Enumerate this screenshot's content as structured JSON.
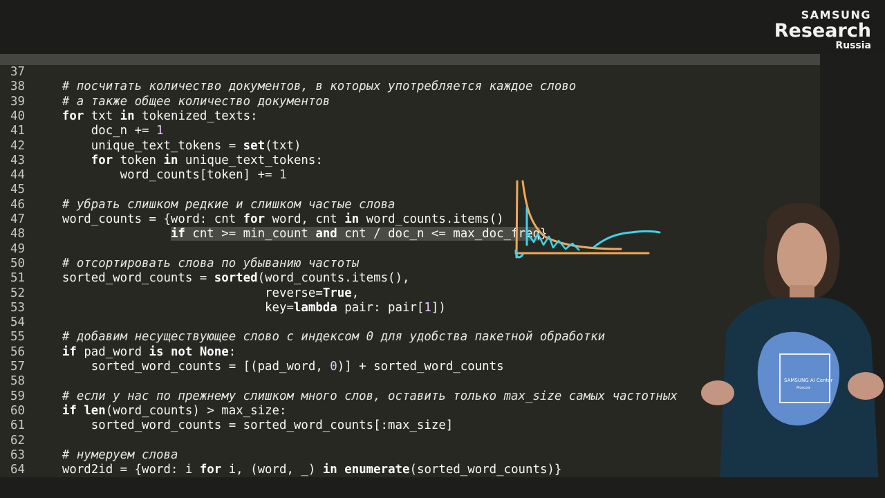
{
  "header": {
    "faded_title": "",
    "brand": {
      "line1": "SAMSUNG",
      "line2": "Research",
      "line3": "Russia"
    }
  },
  "editor": {
    "lines": [
      {
        "n": "37",
        "segs": []
      },
      {
        "n": "38",
        "segs": [
          {
            "t": "    "
          },
          {
            "t": "# посчитать количество документов, в которых употребляется каждое слово",
            "c": "cm"
          }
        ]
      },
      {
        "n": "39",
        "segs": [
          {
            "t": "    "
          },
          {
            "t": "# а также общее количество документов",
            "c": "cm"
          }
        ]
      },
      {
        "n": "40",
        "segs": [
          {
            "t": "    "
          },
          {
            "t": "for",
            "c": "kw"
          },
          {
            "t": " txt "
          },
          {
            "t": "in",
            "c": "kw"
          },
          {
            "t": " tokenized_texts:"
          }
        ]
      },
      {
        "n": "41",
        "segs": [
          {
            "t": "        doc_n += "
          },
          {
            "t": "1",
            "c": "num"
          }
        ]
      },
      {
        "n": "42",
        "segs": [
          {
            "t": "        unique_text_tokens = "
          },
          {
            "t": "set",
            "c": "kw"
          },
          {
            "t": "(txt)"
          }
        ]
      },
      {
        "n": "43",
        "segs": [
          {
            "t": "        "
          },
          {
            "t": "for",
            "c": "kw"
          },
          {
            "t": " token "
          },
          {
            "t": "in",
            "c": "kw"
          },
          {
            "t": " unique_text_tokens:"
          }
        ]
      },
      {
        "n": "44",
        "segs": [
          {
            "t": "            word_counts[token] += "
          },
          {
            "t": "1",
            "c": "num"
          }
        ]
      },
      {
        "n": "45",
        "segs": []
      },
      {
        "n": "46",
        "segs": [
          {
            "t": "    "
          },
          {
            "t": "# убрать слишком редкие и слишком частые слова",
            "c": "cm"
          }
        ]
      },
      {
        "n": "47",
        "segs": [
          {
            "t": "    word_counts = {word: cnt "
          },
          {
            "t": "for",
            "c": "kw"
          },
          {
            "t": " word, cnt "
          },
          {
            "t": "in",
            "c": "kw"
          },
          {
            "t": " word_counts.items()"
          }
        ]
      },
      {
        "n": "48",
        "segs": [
          {
            "t": "                   "
          },
          {
            "t": "if",
            "c": "kw hl"
          },
          {
            "t": " cnt >= min_count ",
            "c": "hl"
          },
          {
            "t": "and",
            "c": "kw hl"
          },
          {
            "t": " cnt / doc_n <= max_doc_freq",
            "c": "hl"
          },
          {
            "t": "}"
          }
        ]
      },
      {
        "n": "49",
        "segs": []
      },
      {
        "n": "50",
        "segs": [
          {
            "t": "    "
          },
          {
            "t": "# отсортировать слова по убыванию частоты",
            "c": "cm"
          }
        ]
      },
      {
        "n": "51",
        "segs": [
          {
            "t": "    sorted_word_counts = "
          },
          {
            "t": "sorted",
            "c": "kw"
          },
          {
            "t": "(word_counts.items(),"
          }
        ]
      },
      {
        "n": "52",
        "segs": [
          {
            "t": "                                reverse="
          },
          {
            "t": "True",
            "c": "kw"
          },
          {
            "t": ","
          }
        ]
      },
      {
        "n": "53",
        "segs": [
          {
            "t": "                                key="
          },
          {
            "t": "lambda",
            "c": "kw"
          },
          {
            "t": " pair: pair["
          },
          {
            "t": "1",
            "c": "num"
          },
          {
            "t": "])"
          }
        ]
      },
      {
        "n": "54",
        "segs": []
      },
      {
        "n": "55",
        "segs": [
          {
            "t": "    "
          },
          {
            "t": "# добавим несуществующее слово с индексом 0 для удобства пакетной обработки",
            "c": "cm"
          }
        ]
      },
      {
        "n": "56",
        "segs": [
          {
            "t": "    "
          },
          {
            "t": "if",
            "c": "kw"
          },
          {
            "t": " pad_word "
          },
          {
            "t": "is not None",
            "c": "kw"
          },
          {
            "t": ":"
          }
        ]
      },
      {
        "n": "57",
        "segs": [
          {
            "t": "        sorted_word_counts = [(pad_word, "
          },
          {
            "t": "0",
            "c": "num"
          },
          {
            "t": ")] + sorted_word_counts"
          }
        ]
      },
      {
        "n": "58",
        "segs": []
      },
      {
        "n": "59",
        "segs": [
          {
            "t": "    "
          },
          {
            "t": "# если у нас по прежнему слишком много слов, оставить только max_size самых частотных",
            "c": "cm"
          }
        ]
      },
      {
        "n": "60",
        "segs": [
          {
            "t": "    "
          },
          {
            "t": "if",
            "c": "kw"
          },
          {
            "t": " "
          },
          {
            "t": "len",
            "c": "kw"
          },
          {
            "t": "(word_counts) > max_size:"
          }
        ]
      },
      {
        "n": "61",
        "segs": [
          {
            "t": "        sorted_word_counts = sorted_word_counts[:max_size]"
          }
        ]
      },
      {
        "n": "62",
        "segs": []
      },
      {
        "n": "63",
        "segs": [
          {
            "t": "    "
          },
          {
            "t": "# нумеруем слова",
            "c": "cm"
          }
        ]
      },
      {
        "n": "64",
        "segs": [
          {
            "t": "    word2id = {word: i "
          },
          {
            "t": "for",
            "c": "kw"
          },
          {
            "t": " i, (word, _) "
          },
          {
            "t": "in",
            "c": "kw"
          },
          {
            "t": " "
          },
          {
            "t": "enumerate",
            "c": "kw"
          },
          {
            "t": "(sorted_word_counts)}"
          }
        ]
      }
    ]
  },
  "sketch": {
    "colors": {
      "orange": "#f0a85a",
      "cyan": "#3fd2ec"
    }
  },
  "presenter": {
    "shirt_print": [
      "SAMSUNG AI Center",
      "Moscow"
    ]
  },
  "colors": {
    "editor_bg": "#272822",
    "page_bg": "#1d1e1c",
    "selection": "#4a4b45"
  }
}
